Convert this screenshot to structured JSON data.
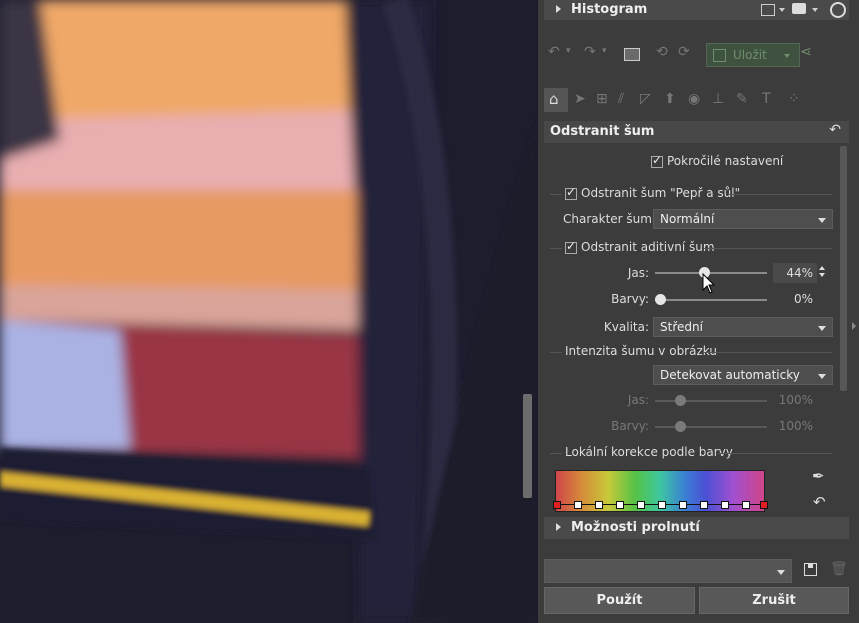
{
  "panel": {
    "histogram_title": "Histogram",
    "save_label": "Uložit",
    "section_title": "Odstranit šum",
    "advanced_settings": "Pokročilé nastavení",
    "salt_pepper": "Odstranit šum \"Pepř a sůl\"",
    "noise_character_label": "Charakter šumu:",
    "noise_character_value": "Normální",
    "additive_noise": "Odstranit aditivní šum",
    "brightness_label": "Jas:",
    "brightness_value": "44%",
    "brightness_level": 44,
    "colors_label": "Barvy:",
    "colors_value": "0%",
    "colors_level": 0,
    "quality_label": "Kvalita:",
    "quality_value": "Střední",
    "intensity_section": "Intenzita šumu v obrázku",
    "intensity_mode": "Detekovat automaticky",
    "int_brightness_label": "Jas:",
    "int_brightness_value": "100%",
    "int_colors_label": "Barvy:",
    "int_colors_value": "100%",
    "local_color_section": "Lokální korekce podle barvy",
    "blend_options": "Možnosti prolnutí",
    "apply_button": "Použít",
    "cancel_button": "Zrušit"
  }
}
